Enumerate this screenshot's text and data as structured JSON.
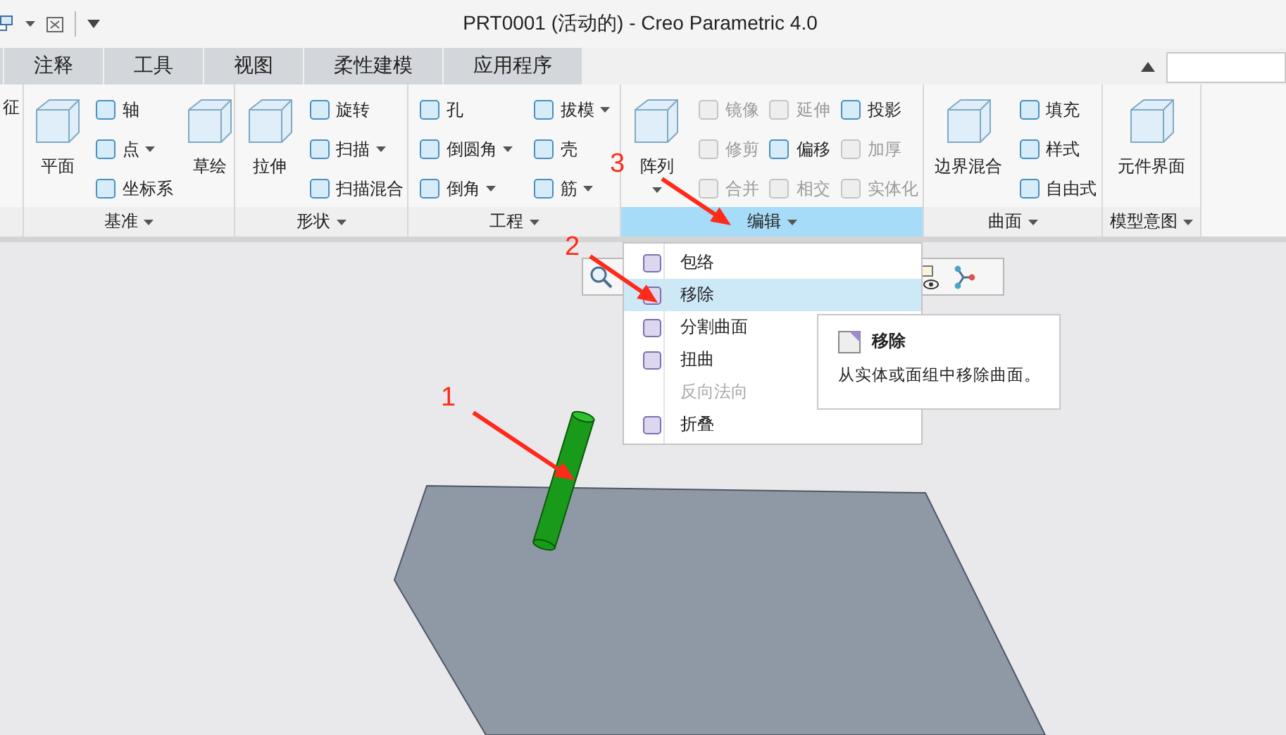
{
  "title_bar": {
    "title": "PRT0001 (活动的) - Creo Parametric 4.0"
  },
  "tabs": [
    {
      "label": "注释",
      "selected": false
    },
    {
      "label": "工具",
      "selected": false
    },
    {
      "label": "视图",
      "selected": false
    },
    {
      "label": "柔性建模",
      "selected": false
    },
    {
      "label": "应用程序",
      "selected": false
    }
  ],
  "ribbon": {
    "groups": [
      {
        "items": [
          {
            "kind": "text",
            "label": "征"
          }
        ]
      },
      {
        "label": "基准",
        "highlighted": false,
        "items": [
          {
            "kind": "large",
            "label": "平面",
            "dropdown": false
          },
          {
            "kind": "column",
            "items": [
              {
                "label": "轴",
                "dropdown": false,
                "disabled": false
              },
              {
                "label": "点",
                "dropdown": true,
                "disabled": false
              },
              {
                "label": "坐标系",
                "dropdown": false,
                "disabled": false
              }
            ]
          },
          {
            "kind": "large",
            "label": "草绘",
            "dropdown": false
          }
        ]
      },
      {
        "label": "形状",
        "highlighted": false,
        "items": [
          {
            "kind": "large",
            "label": "拉伸",
            "dropdown": false
          },
          {
            "kind": "column",
            "items": [
              {
                "label": "旋转",
                "dropdown": false,
                "disabled": false
              },
              {
                "label": "扫描",
                "dropdown": true,
                "disabled": false
              },
              {
                "label": "扫描混合",
                "dropdown": false,
                "disabled": false
              }
            ]
          }
        ]
      },
      {
        "label": "工程",
        "highlighted": false,
        "items": [
          {
            "kind": "column",
            "items": [
              {
                "label": "孔",
                "dropdown": false,
                "disabled": false
              },
              {
                "label": "倒圆角",
                "dropdown": true,
                "disabled": false
              },
              {
                "label": "倒角",
                "dropdown": true,
                "disabled": false
              }
            ]
          },
          {
            "kind": "column",
            "items": [
              {
                "label": "拔模",
                "dropdown": true,
                "disabled": false
              },
              {
                "label": "壳",
                "dropdown": false,
                "disabled": false
              },
              {
                "label": "筋",
                "dropdown": true,
                "disabled": false
              }
            ]
          }
        ]
      },
      {
        "label": "编辑",
        "highlighted": true,
        "items": [
          {
            "kind": "large",
            "label": "阵列",
            "dropdown": true
          },
          {
            "kind": "column",
            "items": [
              {
                "label": "镜像",
                "dropdown": false,
                "disabled": true
              },
              {
                "label": "修剪",
                "dropdown": false,
                "disabled": true
              },
              {
                "label": "合并",
                "dropdown": false,
                "disabled": true
              }
            ]
          },
          {
            "kind": "column",
            "items": [
              {
                "label": "延伸",
                "dropdown": false,
                "disabled": true
              },
              {
                "label": "偏移",
                "dropdown": false,
                "disabled": false
              },
              {
                "label": "相交",
                "dropdown": false,
                "disabled": true
              }
            ]
          },
          {
            "kind": "column",
            "items": [
              {
                "label": "投影",
                "dropdown": false,
                "disabled": false
              },
              {
                "label": "加厚",
                "dropdown": false,
                "disabled": true
              },
              {
                "label": "实体化",
                "dropdown": false,
                "disabled": true
              }
            ]
          }
        ]
      },
      {
        "label": "曲面",
        "highlighted": false,
        "items": [
          {
            "kind": "large",
            "label": "边界混合",
            "dropdown": false
          },
          {
            "kind": "column",
            "items": [
              {
                "label": "填充",
                "dropdown": false,
                "disabled": false
              },
              {
                "label": "样式",
                "dropdown": false,
                "disabled": false
              },
              {
                "label": "自由式",
                "dropdown": false,
                "disabled": false
              }
            ]
          }
        ]
      },
      {
        "label": "模型意图",
        "highlighted": false,
        "items": [
          {
            "kind": "large",
            "label": "元件界面",
            "dropdown": false
          }
        ]
      }
    ]
  },
  "menu": {
    "items": [
      {
        "label": "包络",
        "selected": false,
        "disabled": false,
        "has_icon": true
      },
      {
        "label": "移除",
        "selected": true,
        "disabled": false,
        "has_icon": true
      },
      {
        "label": "分割曲面",
        "selected": false,
        "disabled": false,
        "has_icon": true
      },
      {
        "label": "扭曲",
        "selected": false,
        "disabled": false,
        "has_icon": true
      },
      {
        "label": "反向法向",
        "selected": false,
        "disabled": true,
        "has_icon": false
      },
      {
        "label": "折叠",
        "selected": false,
        "disabled": false,
        "has_icon": true
      }
    ]
  },
  "tooltip": {
    "title": "移除",
    "description": "从实体或面组中移除曲面。"
  },
  "annotations": [
    {
      "label": "1"
    },
    {
      "label": "2"
    },
    {
      "label": "3"
    }
  ]
}
